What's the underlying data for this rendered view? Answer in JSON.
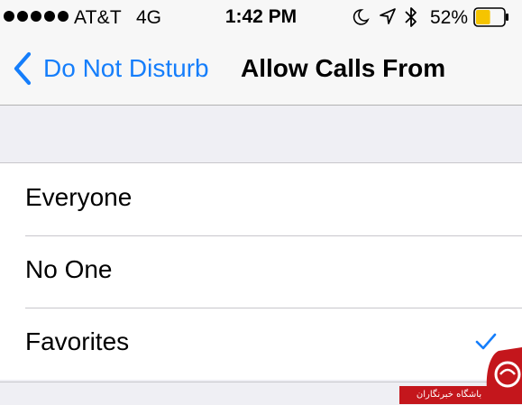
{
  "status_bar": {
    "carrier": "AT&T",
    "network": "4G",
    "time": "1:42 PM",
    "battery_percent": "52%",
    "battery_level": 0.52,
    "battery_color": "#f5c400",
    "icons": [
      "signal-dots",
      "moon-icon",
      "location-icon",
      "bluetooth-icon",
      "battery-icon"
    ]
  },
  "nav": {
    "back_label": "Do Not Disturb",
    "title": "Allow Calls From",
    "accent_color": "#157efb"
  },
  "options": [
    {
      "label": "Everyone",
      "selected": false
    },
    {
      "label": "No One",
      "selected": false
    },
    {
      "label": "Favorites",
      "selected": true
    }
  ],
  "watermark": {
    "text": "باشگاه خبرنگاران"
  }
}
